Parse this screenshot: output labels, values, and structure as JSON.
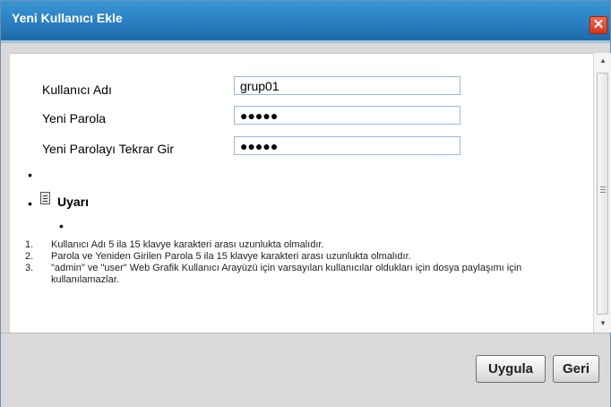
{
  "dialog": {
    "title": "Yeni Kullanıcı Ekle",
    "close_glyph": "✕"
  },
  "form": {
    "username_label": "Kullanıcı Adı",
    "username_value": "grup01",
    "password_label": "Yeni Parola",
    "password_value": "●●●●●",
    "confirm_label": "Yeni Parolayı Tekrar Gir",
    "confirm_value": "●●●●●"
  },
  "bullet_glyph": "•",
  "warning": {
    "title": "Uyarı",
    "items": [
      {
        "num": "1.",
        "text": "Kullanıcı Adı 5 ila 15 klavye karakteri arası uzunlukta olmalıdır."
      },
      {
        "num": "2.",
        "text": "Parola ve Yeniden Girilen Parola 5 ila 15 klavye karakteri arası uzunlukta olmalıdır."
      },
      {
        "num": "3.",
        "text": "\"admin\" ve \"user\" Web Grafik Kullanıcı Arayüzü için varsayılan kullanıcılar oldukları için dosya paylaşımı için kullanılamazlar."
      }
    ]
  },
  "buttons": {
    "apply": "Uygula",
    "back": "Geri"
  },
  "scrollbar": {
    "up_glyph": "▲",
    "down_glyph": "▼"
  }
}
